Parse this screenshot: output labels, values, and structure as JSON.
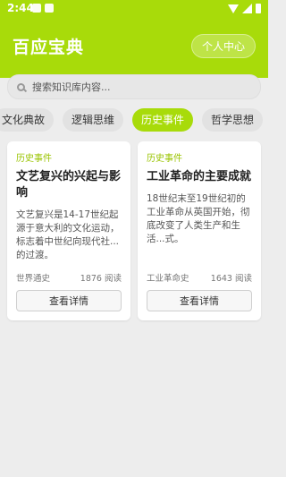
{
  "status_bar": {
    "time": "2:44"
  },
  "header": {
    "title": "百应宝典",
    "profile_button": "个人中心"
  },
  "search": {
    "placeholder": "搜索知识库内容..."
  },
  "tabs": [
    {
      "label": "文化典故",
      "active": false
    },
    {
      "label": "逻辑思维",
      "active": false
    },
    {
      "label": "历史事件",
      "active": true
    },
    {
      "label": "哲学思想",
      "active": false
    }
  ],
  "cards": [
    {
      "tag": "历史事件",
      "title": "文艺复兴的兴起与影响",
      "description": "文艺复兴是14-17世纪起源于意大利的文化运动，标志着中世纪向现代社...的过渡。",
      "source": "世界通史",
      "reads": "1876 阅读",
      "button": "查看详情"
    },
    {
      "tag": "历史事件",
      "title": "工业革命的主要成就",
      "description": "18世纪末至19世纪初的工业革命从英国开始，彻底改变了人类生产和生活...式。",
      "source": "工业革命史",
      "reads": "1643 阅读",
      "button": "查看详情"
    }
  ],
  "colors": {
    "accent": "#a8db0a",
    "background": "#ededed"
  }
}
